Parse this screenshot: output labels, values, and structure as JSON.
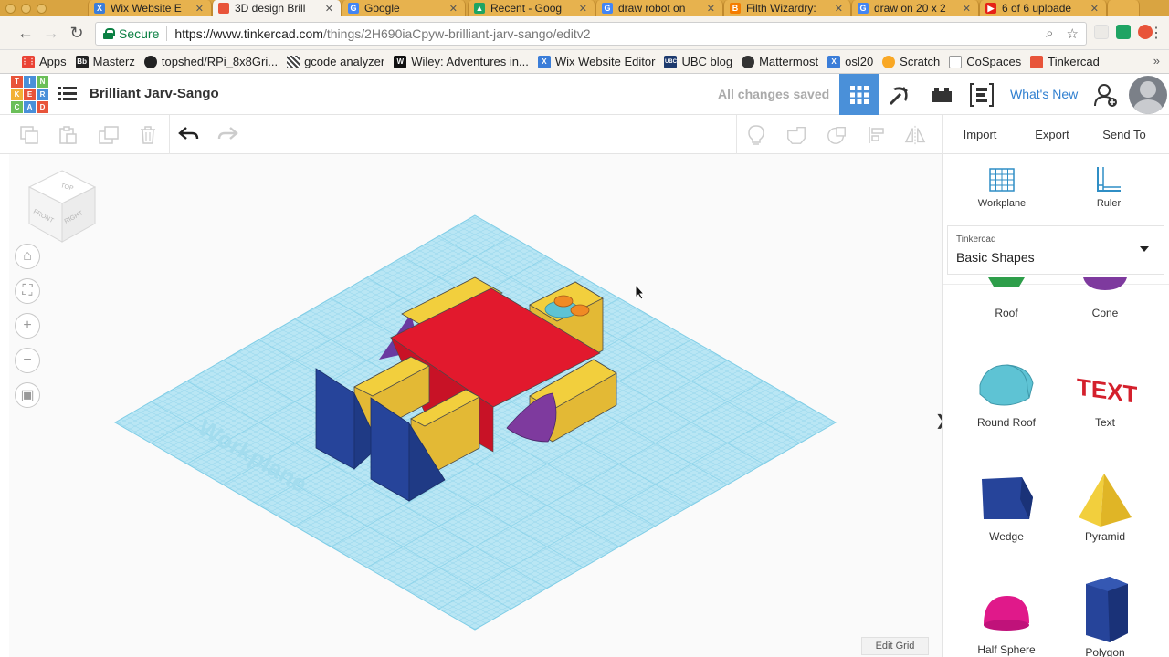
{
  "browser": {
    "tabs": [
      {
        "title": "Wix Website E",
        "color": "#3b7dd8"
      },
      {
        "title": "3D design Brill",
        "color": "#e8543a"
      },
      {
        "title": "Google",
        "color": "#4285f4"
      },
      {
        "title": "Recent - Goog",
        "color": "#1fa463"
      },
      {
        "title": "draw robot on",
        "color": "#4285f4"
      },
      {
        "title": "Filth Wizardry:",
        "color": "#f57d00"
      },
      {
        "title": "draw on 20 x 2",
        "color": "#4285f4"
      },
      {
        "title": "6 of 6 uploade",
        "color": "#e62117"
      }
    ],
    "secure_label": "Secure",
    "url_host": "https://www.tinkercad.com",
    "url_path": "/things/2H690iaCpyw-brilliant-jarv-sango/editv2"
  },
  "bookmarks": [
    {
      "label": "Apps",
      "color": "#ea4335",
      "glyph": ""
    },
    {
      "label": "Masterz",
      "color": "#222",
      "glyph": "Bb"
    },
    {
      "label": "topshed/RPi_8x8Gri...",
      "color": "#222",
      "glyph": ""
    },
    {
      "label": "gcode analyzer",
      "color": "#444",
      "glyph": ""
    },
    {
      "label": "Wiley: Adventures in...",
      "color": "#111",
      "glyph": "W"
    },
    {
      "label": "Wix Website Editor",
      "color": "#3b7dd8",
      "glyph": "X"
    },
    {
      "label": "UBC blog",
      "color": "#1d3a6e",
      "glyph": "UBC"
    },
    {
      "label": "Mattermost",
      "color": "#333",
      "glyph": ""
    },
    {
      "label": "osl20",
      "color": "#3b7dd8",
      "glyph": "X"
    },
    {
      "label": "Scratch",
      "color": "#f9a825",
      "glyph": ""
    },
    {
      "label": "CoSpaces",
      "color": "#999",
      "glyph": ""
    },
    {
      "label": "Tinkercad",
      "color": "#e8543a",
      "glyph": ""
    }
  ],
  "app": {
    "logo_letters": [
      "T",
      "I",
      "N",
      "K",
      "E",
      "R",
      "C",
      "A",
      "D"
    ],
    "logo_colors": [
      "#e8543a",
      "#4a90d9",
      "#6bbf59",
      "#f2b134",
      "#e8543a",
      "#4a90d9",
      "#6bbf59",
      "#4a90d9",
      "#e8543a"
    ],
    "design_title": "Brilliant Jarv-Sango",
    "save_status": "All changes saved",
    "whats_new": "What's New"
  },
  "toolbar": {
    "import_label": "Import",
    "export_label": "Export",
    "send_to_label": "Send To"
  },
  "canvas": {
    "workplane_label": "Workplane",
    "edit_grid_label": "Edit Grid",
    "viewcube": {
      "top": "TOP",
      "front": "FRONT",
      "right": "RIGHT"
    }
  },
  "panel": {
    "workplane_label": "Workplane",
    "ruler_label": "Ruler",
    "library_small": "Tinkercad",
    "library_name": "Basic Shapes",
    "shapes": [
      {
        "label": "Roof",
        "color": "#2e9e4a"
      },
      {
        "label": "Cone",
        "color": "#7e3a9e"
      },
      {
        "label": "Round Roof",
        "color": "#5ec3d4"
      },
      {
        "label": "Text",
        "color": "#d4202c"
      },
      {
        "label": "Wedge",
        "color": "#1f3f8f"
      },
      {
        "label": "Pyramid",
        "color": "#f0c419"
      },
      {
        "label": "Half Sphere",
        "color": "#e0198a"
      },
      {
        "label": "Polygon",
        "color": "#1f3f8f"
      }
    ]
  }
}
